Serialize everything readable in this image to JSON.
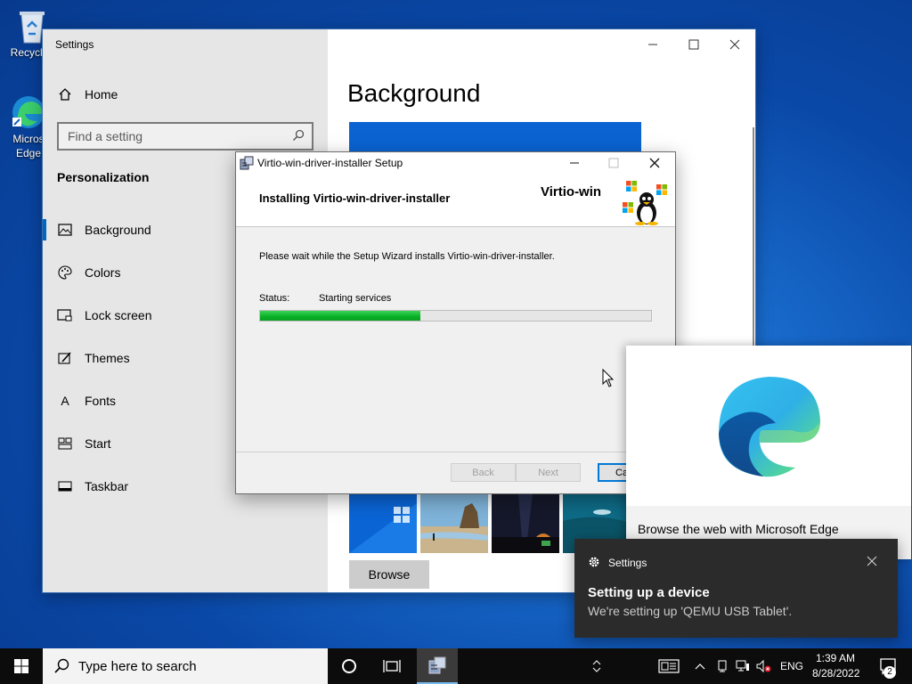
{
  "desktop": {
    "icons": [
      {
        "label": "Recycle"
      },
      {
        "label": "Micros Edge"
      }
    ]
  },
  "settings": {
    "window_title": "Settings",
    "home_label": "Home",
    "search_placeholder": "Find a setting",
    "section_title": "Personalization",
    "nav_items": [
      {
        "label": "Background",
        "icon": "picture-icon",
        "active": true
      },
      {
        "label": "Colors",
        "icon": "palette-icon"
      },
      {
        "label": "Lock screen",
        "icon": "lock-screen-icon"
      },
      {
        "label": "Themes",
        "icon": "themes-brush-icon"
      },
      {
        "label": "Fonts",
        "icon": "fonts-icon",
        "icon_text": "A"
      },
      {
        "label": "Start",
        "icon": "start-grid-icon"
      },
      {
        "label": "Taskbar",
        "icon": "taskbar-icon"
      }
    ],
    "page_title": "Background",
    "browse_label": "Browse"
  },
  "setup": {
    "title": "Virtio-win-driver-installer Setup",
    "banner_title": "Installing Virtio-win-driver-installer",
    "brand": "Virtio-win",
    "message": "Please wait while the Setup Wizard installs Virtio-win-driver-installer.",
    "status_label": "Status:",
    "status_value": "Starting services",
    "progress_percent": 41,
    "buttons": {
      "back": "Back",
      "next": "Next",
      "cancel": "Ca"
    }
  },
  "edge_card": {
    "text": "Browse the web with Microsoft Edge"
  },
  "toast": {
    "app": "Settings",
    "heading": "Setting up a device",
    "body": "We're setting up 'QEMU USB Tablet'."
  },
  "taskbar": {
    "search_placeholder": "Type here to search",
    "language": "ENG",
    "time": "1:39 AM",
    "date": "8/28/2022",
    "notification_count": "2"
  },
  "colors": {
    "accent": "#0067c0",
    "progress_green": "#06b025",
    "desktop_blue": "#1768c9"
  }
}
